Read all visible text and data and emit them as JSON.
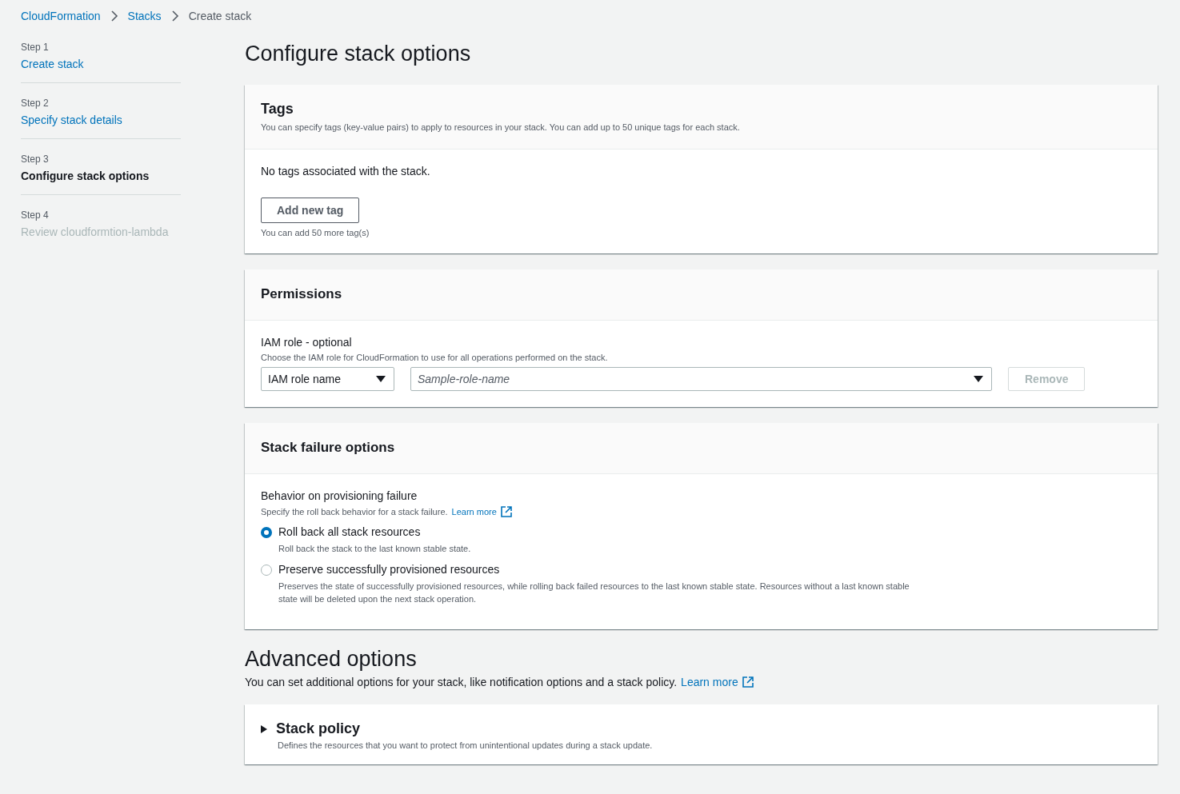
{
  "breadcrumbs": [
    {
      "label": "CloudFormation",
      "link": true
    },
    {
      "label": "Stacks",
      "link": true
    },
    {
      "label": "Create stack",
      "link": false
    }
  ],
  "steps": [
    {
      "step": "Step 1",
      "label": "Create stack",
      "selected": false,
      "disabled": false
    },
    {
      "step": "Step 2",
      "label": "Specify stack details",
      "selected": false,
      "disabled": false
    },
    {
      "step": "Step 3",
      "label": "Configure stack options",
      "selected": true,
      "disabled": false
    },
    {
      "step": "Step 4",
      "label": "Review cloudformtion-lambda",
      "selected": false,
      "disabled": true
    }
  ],
  "title": "Configure stack options",
  "tags": {
    "title": "Tags",
    "description": "You can specify tags (key-value pairs) to apply to resources in your stack. You can add up to 50 unique tags for each stack.",
    "empty_text": "No tags associated with the stack.",
    "button": "Add new tag",
    "hint": "You can add 50 more tag(s)"
  },
  "permissions": {
    "title": "Permissions",
    "label": "IAM role - optional",
    "description": "Choose the IAM role for CloudFormation to use for all operations performed on the stack.",
    "type_select": "IAM role name",
    "role_placeholder": "Sample-role-name",
    "remove_button": "Remove",
    "remove_disabled": true
  },
  "failure": {
    "title": "Stack failure options",
    "label": "Behavior on provisioning failure",
    "description": "Specify the roll back behavior for a stack failure.",
    "learn_more": "Learn more",
    "options": [
      {
        "label": "Roll back all stack resources",
        "description": "Roll back the stack to the last known stable state.",
        "selected": true
      },
      {
        "label": "Preserve successfully provisioned resources",
        "description": "Preserves the state of successfully provisioned resources, while rolling back failed resources to the last known stable state. Resources without a last known stable state will be deleted upon the next stack operation.",
        "selected": false
      }
    ]
  },
  "advanced": {
    "title": "Advanced options",
    "description": "You can set additional options for your stack, like notification options and a stack policy.",
    "learn_more": "Learn more",
    "sections": [
      {
        "title": "Stack policy",
        "description": "Defines the resources that you want to protect from unintentional updates during a stack update.",
        "expanded": false
      }
    ]
  }
}
